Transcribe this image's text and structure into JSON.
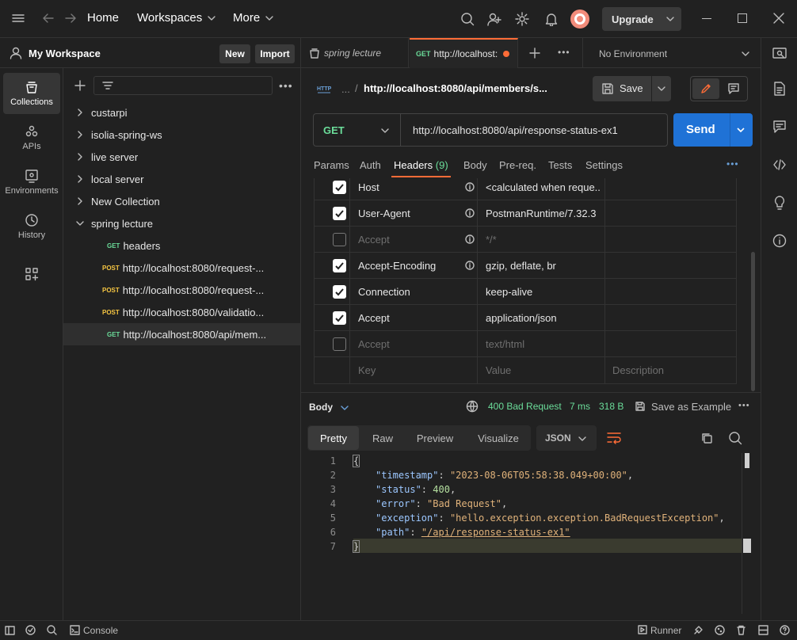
{
  "topbar": {
    "home": "Home",
    "workspaces": "Workspaces",
    "more": "More",
    "upgrade": "Upgrade"
  },
  "workspace": {
    "name": "My Workspace",
    "new_label": "New",
    "import_label": "Import"
  },
  "rail": [
    {
      "label": "Collections",
      "icon": "collections-icon"
    },
    {
      "label": "APIs",
      "icon": "apis-icon"
    },
    {
      "label": "Environments",
      "icon": "environments-icon"
    },
    {
      "label": "History",
      "icon": "history-icon"
    }
  ],
  "tree": {
    "collections": [
      "custarpi",
      "isolia-spring-ws",
      "live server",
      "local server",
      "New Collection",
      "spring lecture"
    ],
    "requests": [
      {
        "method": "GET",
        "name": "headers"
      },
      {
        "method": "POST",
        "name": "http://localhost:8080/request-..."
      },
      {
        "method": "POST",
        "name": "http://localhost:8080/request-..."
      },
      {
        "method": "POST",
        "name": "http://localhost:8080/validatio..."
      },
      {
        "method": "GET",
        "name": "http://localhost:8080/api/mem..."
      }
    ]
  },
  "tabs": {
    "tab1": "spring lecture",
    "tab2_method": "GET",
    "tab2": "http://localhost:",
    "environment": "No Environment"
  },
  "request": {
    "breadcrumb_ellipsis": "...",
    "title": "http://localhost:8080/api/members/s...",
    "save_label": "Save",
    "method": "GET",
    "url": "http://localhost:8080/api/response-status-ex1",
    "send_label": "Send",
    "subtabs": [
      "Params",
      "Auth",
      "Headers",
      "Body",
      "Pre-req.",
      "Tests",
      "Settings"
    ],
    "headers_count": "(9)"
  },
  "headers": [
    {
      "key": "Host",
      "value": "<calculated when reque...",
      "checked": true,
      "info": true
    },
    {
      "key": "User-Agent",
      "value": "PostmanRuntime/7.32.3",
      "checked": true,
      "info": true
    },
    {
      "key": "Accept",
      "value": "*/*",
      "checked": false,
      "info": true
    },
    {
      "key": "Accept-Encoding",
      "value": "gzip, deflate, br",
      "checked": true,
      "info": true
    },
    {
      "key": "Connection",
      "value": "keep-alive",
      "checked": true,
      "info": false
    },
    {
      "key": "Accept",
      "value": "application/json",
      "checked": true,
      "info": false
    },
    {
      "key": "Accept",
      "value": "text/html",
      "checked": false,
      "info": false
    }
  ],
  "headers_placeholder": {
    "key": "Key",
    "value": "Value",
    "description": "Description"
  },
  "response": {
    "body_label": "Body",
    "status": "400 Bad Request",
    "time": "7 ms",
    "size": "318 B",
    "save_example": "Save as Example",
    "views": [
      "Pretty",
      "Raw",
      "Preview",
      "Visualize"
    ],
    "format": "JSON",
    "lines": [
      "1",
      "2",
      "3",
      "4",
      "5",
      "6",
      "7"
    ],
    "json": {
      "open": "{",
      "timestamp_key": "\"timestamp\"",
      "timestamp_val": "\"2023-08-06T05:58:38.049+00:00\"",
      "status_key": "\"status\"",
      "status_val": "400",
      "error_key": "\"error\"",
      "error_val": "\"Bad Request\"",
      "exception_key": "\"exception\"",
      "exception_val": "\"hello.exception.exception.BadRequestException\"",
      "path_key": "\"path\"",
      "path_val": "\"/api/response-status-ex1\"",
      "close": "}"
    }
  },
  "footer": {
    "console": "Console",
    "runner": "Runner"
  },
  "colors": {
    "send": "#1f72d6",
    "get": "#6bdd9a",
    "post": "#f5c542",
    "status_ok_text": "#6bdd9a",
    "accent": "#ff6c37"
  }
}
